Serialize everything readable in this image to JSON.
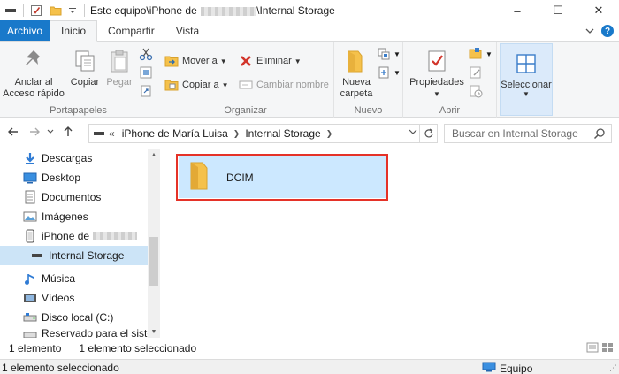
{
  "window": {
    "title_prefix": "Este equipo\\iPhone de",
    "title_suffix": "\\Internal Storage",
    "minimize": "–",
    "maximize": "☐",
    "close": "✕"
  },
  "tabs": {
    "file": "Archivo",
    "home": "Inicio",
    "share": "Compartir",
    "view": "Vista"
  },
  "ribbon": {
    "clipboard": {
      "label": "Portapapeles",
      "pin": "Anclar al Acceso rápido",
      "copy": "Copiar",
      "paste": "Pegar"
    },
    "organize": {
      "label": "Organizar",
      "move_to": "Mover a",
      "copy_to": "Copiar a",
      "delete": "Eliminar",
      "rename": "Cambiar nombre"
    },
    "new": {
      "label": "Nuevo",
      "new_folder": "Nueva carpeta"
    },
    "open": {
      "label": "Abrir",
      "properties": "Propiedades"
    },
    "select": {
      "label": "Seleccionar"
    }
  },
  "address": {
    "overflow": "«",
    "crumbs": [
      "iPhone de María Luisa",
      "Internal Storage"
    ],
    "search_placeholder": "Buscar en Internal Storage"
  },
  "nav_pane": {
    "items": [
      {
        "label": "Descargas"
      },
      {
        "label": "Desktop"
      },
      {
        "label": "Documentos"
      },
      {
        "label": "Imágenes"
      },
      {
        "label": "iPhone de"
      },
      {
        "label": "Internal Storage"
      },
      {
        "label": "Música"
      },
      {
        "label": "Vídeos"
      },
      {
        "label": "Disco local (C:)"
      },
      {
        "label": "Reservado para el sistema"
      }
    ]
  },
  "content": {
    "items": [
      {
        "name": "DCIM"
      }
    ]
  },
  "status": {
    "count": "1 elemento",
    "selected": "1 elemento seleccionado",
    "bottom_left": "1 elemento seleccionado",
    "bottom_right": "Equipo"
  },
  "colors": {
    "accent": "#1979ca",
    "selection": "#cce8ff",
    "highlight_border": "#e53228",
    "folder": "#f5c14b"
  }
}
